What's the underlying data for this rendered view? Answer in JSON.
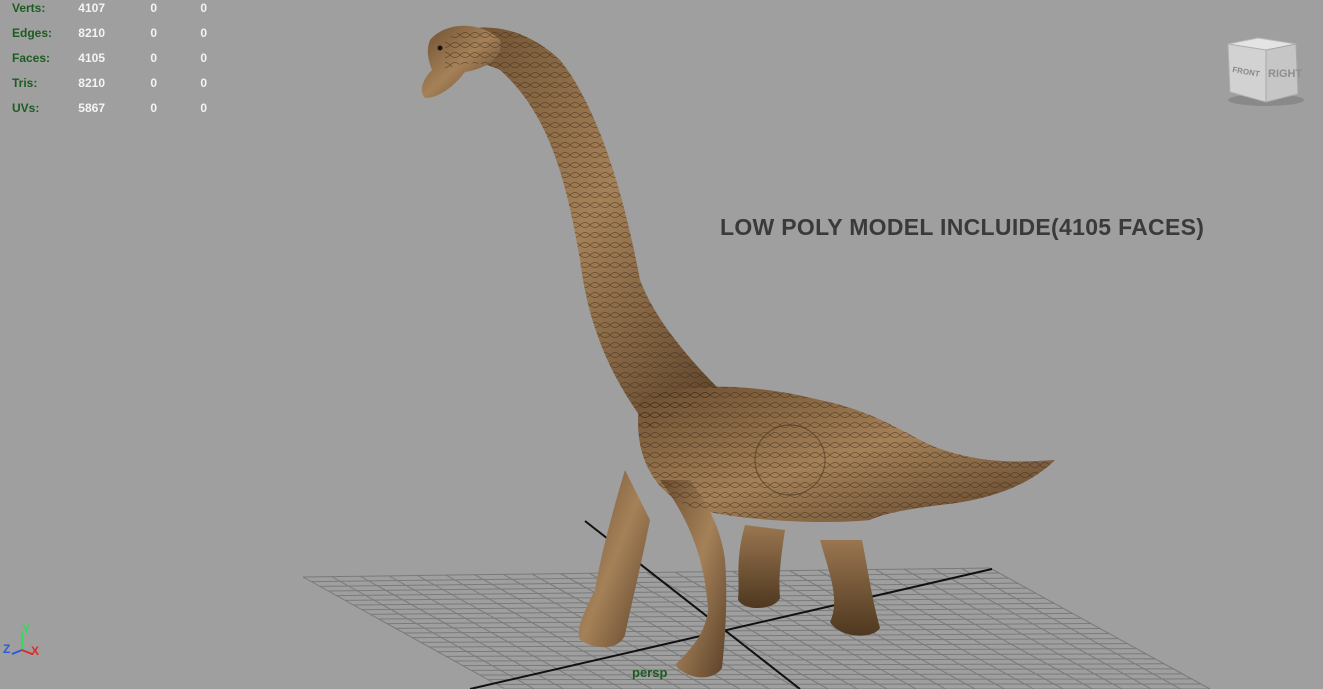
{
  "hud": {
    "rows": [
      {
        "label": "Verts:",
        "values": [
          "4107",
          "0",
          "0"
        ]
      },
      {
        "label": "Edges:",
        "values": [
          "8210",
          "0",
          "0"
        ]
      },
      {
        "label": "Faces:",
        "values": [
          "4105",
          "0",
          "0"
        ]
      },
      {
        "label": "Tris:",
        "values": [
          "8210",
          "0",
          "0"
        ]
      },
      {
        "label": "UVs:",
        "values": [
          "5867",
          "0",
          "0"
        ]
      }
    ]
  },
  "headline": "LOW POLY MODEL INCLUIDE(4105 FACES)",
  "camera_label": "persp",
  "viewcube": {
    "front_face": "RIGHT",
    "side_face": "FRONT"
  },
  "axis_gizmo": {
    "y": "Y",
    "z": "Z",
    "x": "X"
  },
  "colors": {
    "viewport_bg": "#9f9f9f",
    "hud_label": "#1c5c22",
    "hud_value": "#f4f4f4",
    "grid_line": "#6e6e6e",
    "grid_axis": "#111111",
    "model_skin": "#8a6a45"
  }
}
